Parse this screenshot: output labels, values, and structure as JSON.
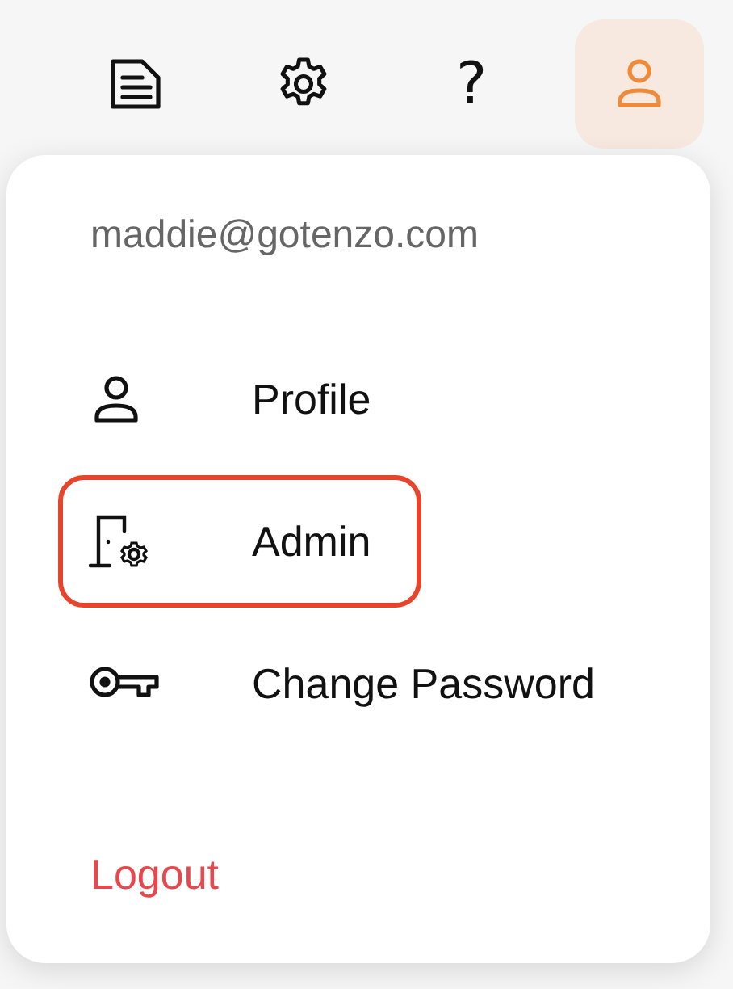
{
  "toolbar": [
    {
      "selected": false
    },
    {
      "selected": false
    },
    {
      "label": "?",
      "selected": false
    },
    {
      "selected": true
    }
  ],
  "account_menu": {
    "email": "maddie@gotenzo.com",
    "items": [
      {
        "label": "Profile",
        "highlighted": false
      },
      {
        "label": "Admin",
        "highlighted": true
      },
      {
        "label": "Change Password",
        "highlighted": false
      }
    ],
    "logout": "Logout"
  }
}
